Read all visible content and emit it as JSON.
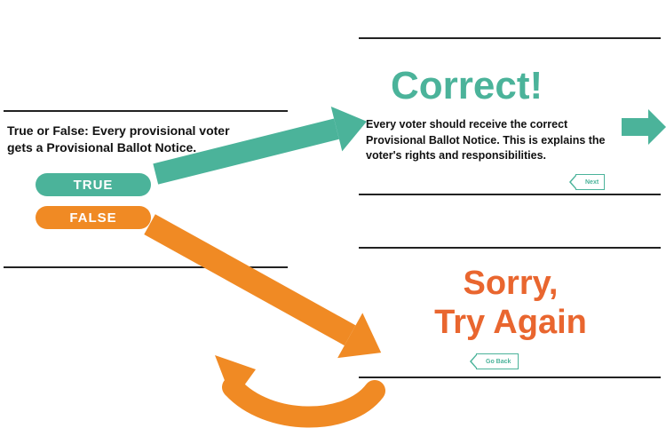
{
  "question": {
    "prompt": "True or False:  Every provisional voter gets a Provisional Ballot Notice.",
    "true_label": "TRUE",
    "false_label": "FALSE"
  },
  "correct": {
    "heading": "Correct!",
    "explanation": "Every voter should receive the correct Provisional Ballot Notice. This is explains the voter's rights and responsibilities.",
    "next_label": "Next"
  },
  "incorrect": {
    "heading_line1": "Sorry,",
    "heading_line2": "Try Again",
    "back_label": "Go Back"
  },
  "colors": {
    "teal": "#4bb39a",
    "orange": "#f08a24",
    "orange_deep": "#e9662f"
  }
}
